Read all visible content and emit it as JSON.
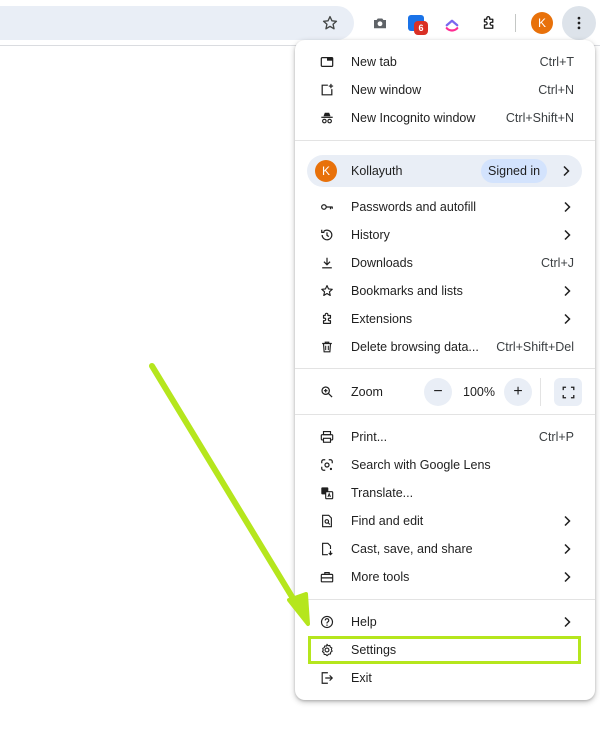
{
  "toolbar": {
    "extension_badge": "6",
    "avatar_letter": "K"
  },
  "menu": {
    "new_tab": {
      "label": "New tab",
      "shortcut": "Ctrl+T"
    },
    "new_window": {
      "label": "New window",
      "shortcut": "Ctrl+N"
    },
    "new_incognito": {
      "label": "New Incognito window",
      "shortcut": "Ctrl+Shift+N"
    },
    "profile": {
      "avatar_letter": "K",
      "name": "Kollayuth",
      "status": "Signed in"
    },
    "passwords": {
      "label": "Passwords and autofill"
    },
    "history": {
      "label": "History"
    },
    "downloads": {
      "label": "Downloads",
      "shortcut": "Ctrl+J"
    },
    "bookmarks": {
      "label": "Bookmarks and lists"
    },
    "extensions": {
      "label": "Extensions"
    },
    "delete_data": {
      "label": "Delete browsing data...",
      "shortcut": "Ctrl+Shift+Del"
    },
    "zoom": {
      "label": "Zoom",
      "minus": "−",
      "value": "100%",
      "plus": "+"
    },
    "print": {
      "label": "Print...",
      "shortcut": "Ctrl+P"
    },
    "google_lens": {
      "label": "Search with Google Lens"
    },
    "translate": {
      "label": "Translate..."
    },
    "find_edit": {
      "label": "Find and edit"
    },
    "cast_save": {
      "label": "Cast, save, and share"
    },
    "more_tools": {
      "label": "More tools"
    },
    "help": {
      "label": "Help"
    },
    "settings": {
      "label": "Settings"
    },
    "exit": {
      "label": "Exit"
    }
  },
  "colors": {
    "highlight": "#b5e61d",
    "avatar": "#e8710a",
    "pill": "#d3e3fd"
  }
}
